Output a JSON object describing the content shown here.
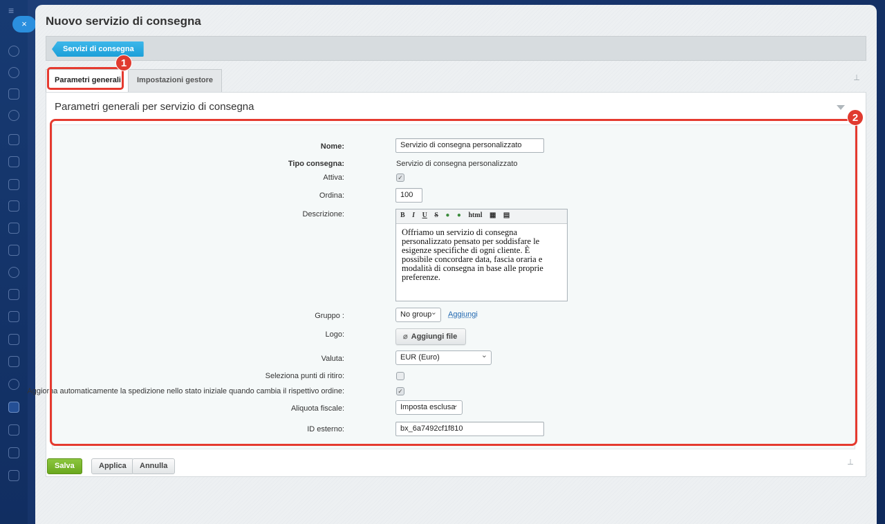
{
  "page": {
    "title": "Nuovo servizio di consegna",
    "close_symbol": "×",
    "breadcrumb": "Servizi di consegna"
  },
  "tabs": [
    {
      "label": "Parametri generali",
      "active": true
    },
    {
      "label": "Impostazioni gestore",
      "active": false
    }
  ],
  "badges": {
    "one": "1",
    "two": "2"
  },
  "section": {
    "title": "Parametri generali per servizio di consegna"
  },
  "form": {
    "name_label": "Nome:",
    "name_value": "Servizio di consegna personalizzato",
    "type_label": "Tipo consegna:",
    "type_value": "Servizio di consegna personalizzato",
    "active_label": "Attiva:",
    "active_checked": true,
    "order_label": "Ordina:",
    "order_value": "100",
    "description_label": "Descrizione:",
    "editor_toolbar": [
      "B",
      "I",
      "U",
      "S",
      "html"
    ],
    "description_text": "Offriamo un servizio di consegna personalizzato pensato per soddisfare le esigenze specifiche di ogni cliente. È possibile concordare data, fascia oraria e modalità di consegna in base alle proprie preferenze.",
    "group_label": "Gruppo :",
    "group_value": "No group",
    "group_add_link": "Aggiungi",
    "logo_label": "Logo:",
    "logo_button": "Aggiungi file",
    "currency_label": "Valuta:",
    "currency_value": "EUR (Euro)",
    "pickup_label": "Seleziona punti di ritiro:",
    "pickup_checked": false,
    "auto_update_label": "Aggiorna automaticamente la spedizione nello stato iniziale quando cambia il rispettivo ordine:",
    "auto_update_checked": true,
    "tax_label": "Aliquota fiscale:",
    "tax_value": "Imposta esclusa",
    "external_id_label": "ID esterno:",
    "external_id_value": "bx_6a7492cf1f810"
  },
  "buttons": {
    "save": "Salva",
    "apply": "Applica",
    "cancel": "Annulla"
  },
  "colors": {
    "accent": "#2b8fde",
    "highlight": "#e53a2f",
    "save_green": "#7ab72e"
  }
}
